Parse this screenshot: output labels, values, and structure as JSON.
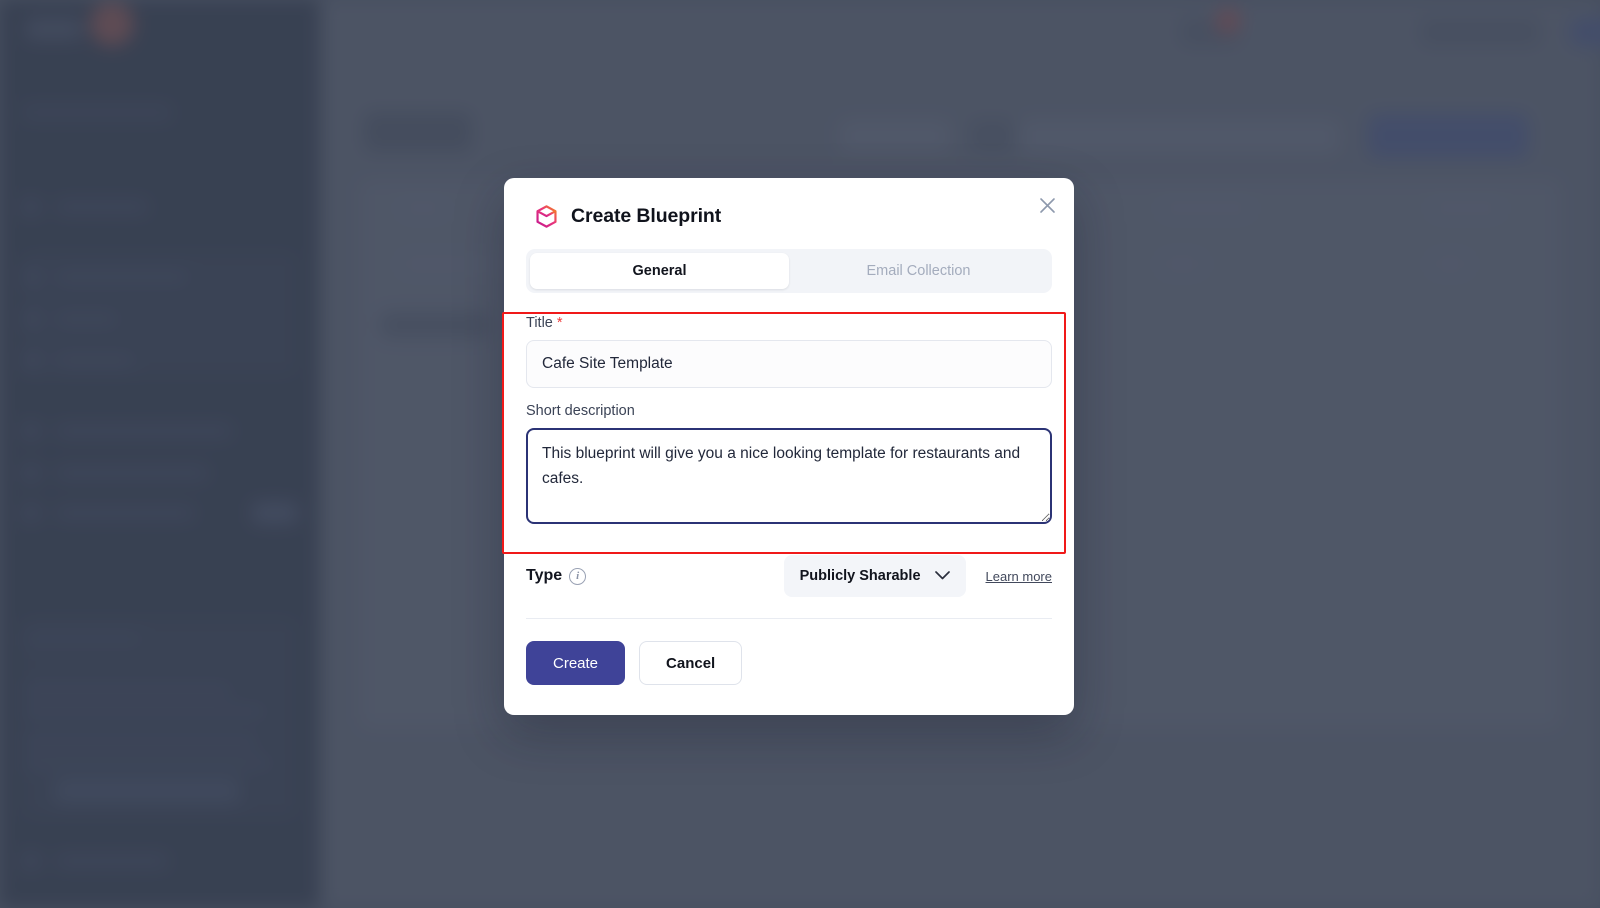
{
  "overlay": {
    "scrim_color": "#474f60"
  },
  "background_app": {
    "sidebar": {
      "background_color": "#141d30",
      "blurred": true
    },
    "content": {
      "background_color": "#5b6171",
      "blurred": true
    }
  },
  "modal": {
    "title": "Create Blueprint",
    "icon": "cube-icon",
    "icon_gradient_from": "#d6219b",
    "icon_gradient_to": "#f47b20",
    "close_icon": "close-icon",
    "tabs": [
      {
        "label": "General",
        "active": true
      },
      {
        "label": "Email Collection",
        "active": false
      }
    ],
    "fields": {
      "title": {
        "label": "Title",
        "required_marker": "*",
        "value": "Cafe Site Template",
        "placeholder": "Title"
      },
      "description": {
        "label": "Short description",
        "value": "This blueprint will give you a nice looking template for restaurants and cafes.",
        "placeholder": "Short description",
        "focused": true
      }
    },
    "type_row": {
      "label": "Type",
      "info_icon": "info-icon",
      "info_glyph": "i",
      "selected_option": "Publicly Sharable",
      "dropdown_icon": "chevron-down-icon",
      "learn_more": "Learn more"
    },
    "actions": {
      "create_label": "Create",
      "cancel_label": "Cancel",
      "primary_color": "#3f4398"
    },
    "highlight": {
      "color": "#f01919",
      "note": "validation highlight around Title and Short description"
    }
  }
}
